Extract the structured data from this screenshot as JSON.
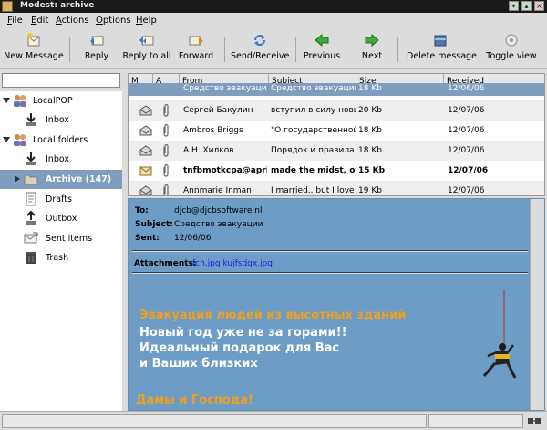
{
  "window": {
    "title": "Modest: archive"
  },
  "menu": [
    {
      "label": "File",
      "u": "F",
      "rest": "ile"
    },
    {
      "label": "Edit",
      "u": "E",
      "rest": "dit"
    },
    {
      "label": "Actions",
      "u": "A",
      "rest": "ctions"
    },
    {
      "label": "Options",
      "u": "O",
      "rest": "ptions"
    },
    {
      "label": "Help",
      "u": "H",
      "rest": "elp"
    }
  ],
  "toolbar": {
    "new_message": "New Message",
    "reply": "Reply",
    "reply_all": "Reply to all",
    "forward": "Forward",
    "send_receive": "Send/Receive",
    "previous": "Previous",
    "next": "Next",
    "delete_message": "Delete message",
    "toggle_view": "Toggle view"
  },
  "folders": {
    "localpop": "LocalPOP",
    "localpop_inbox": "Inbox",
    "local_folders": "Local folders",
    "inbox": "Inbox",
    "archive": "Archive (147)",
    "drafts": "Drafts",
    "outbox": "Outbox",
    "sent": "Sent items",
    "trash": "Trash"
  },
  "headers": {
    "columns": {
      "m": "M",
      "a": "A",
      "from": "From",
      "subject": "Subject",
      "size": "Size",
      "received": "Received"
    },
    "rows": [
      {
        "from": "Средство эвакуации",
        "subject": "Средство эвакуации",
        "size": "18 Kb",
        "received": "12/06/06"
      },
      {
        "from": "Сергей Бакулин",
        "subject": "вступил в силу новь",
        "size": "20 Kb",
        "received": "12/07/06"
      },
      {
        "from": "Ambros Briggs",
        "subject": "\"О государственной",
        "size": "18 Kb",
        "received": "12/07/06"
      },
      {
        "from": "А.Н. Хилков",
        "subject": "Порядок и правила р",
        "size": "18 Kb",
        "received": "12/07/06"
      },
      {
        "from": "tnfbmotkcpa@april!",
        "subject": "made the midst, of",
        "size": "15 Kb",
        "received": "12/07/06"
      },
      {
        "from": "Annmarie Inman",
        "subject": "I married.. but I love v",
        "size": "19 Kb",
        "received": "12/07/06"
      }
    ]
  },
  "message": {
    "to_label": "To:",
    "to": "djcb@djcbsoftware.nl",
    "subject_label": "Subject:",
    "subject": "Средство эвакуации",
    "sent_label": "Sent:",
    "sent": "12/06/06",
    "attachments_label": "Attachments:",
    "attachments": "fch.jpg  kujfsdqx.jpg",
    "promo_line1": "Эвакуация людей из высотных зданий",
    "promo_line2": "Новый год уже не за горами!!",
    "promo_line3": "Идеальный подарок для Вас",
    "promo_line4": "и Ваших близких",
    "promo_line5": "Дамы и Господа!"
  },
  "colors": {
    "selection": "#7f9dbf",
    "message_bg": "#6d9cc7",
    "promo_orange": "#f0a020",
    "promo_white": "#ffffff"
  }
}
